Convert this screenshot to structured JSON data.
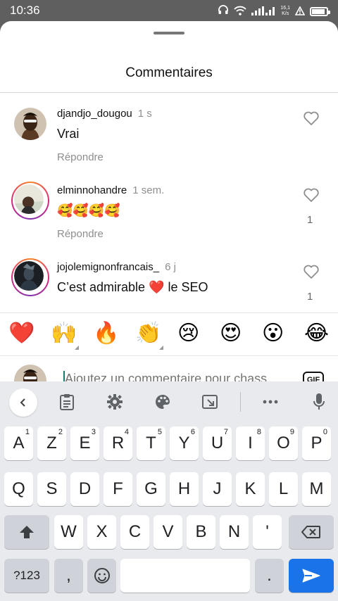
{
  "status_bar": {
    "time": "10:36",
    "net_speed_value": "16,1",
    "net_speed_unit": "K/s",
    "battery_percent": 90
  },
  "sheet": {
    "title": "Commentaires"
  },
  "comments": [
    {
      "username": "djandjo_dougou",
      "time": "1 s",
      "text": "Vrai",
      "reply_label": "Répondre",
      "likes": "",
      "story_ring": false
    },
    {
      "username": "elminnohandre",
      "time": "1 sem.",
      "text": "🥰🥰🥰🥰",
      "reply_label": "Répondre",
      "likes": "1",
      "story_ring": true
    },
    {
      "username": "jojolemignonfrancais_",
      "time": "6 j",
      "text": "C’est admirable ❤️ le SEO",
      "reply_label": "",
      "likes": "1",
      "story_ring": true
    }
  ],
  "emoji_bar": [
    "❤️",
    "🙌",
    "🔥",
    "👏",
    "😢",
    "😍",
    "😮",
    "😂"
  ],
  "comment_input": {
    "placeholder": "Ajoutez un commentaire pour chass",
    "gif_label": "GIF"
  },
  "keyboard": {
    "toolbar": [
      "back-icon",
      "clipboard-icon",
      "settings-icon",
      "theme-palette-icon",
      "screen-size-icon",
      "more-icon",
      "mic-icon"
    ],
    "row1": [
      {
        "key": "A",
        "hint": "1"
      },
      {
        "key": "Z",
        "hint": "2"
      },
      {
        "key": "E",
        "hint": "3"
      },
      {
        "key": "R",
        "hint": "4"
      },
      {
        "key": "T",
        "hint": "5"
      },
      {
        "key": "Y",
        "hint": "6"
      },
      {
        "key": "U",
        "hint": "7"
      },
      {
        "key": "I",
        "hint": "8"
      },
      {
        "key": "O",
        "hint": "9"
      },
      {
        "key": "P",
        "hint": "0"
      }
    ],
    "row2": [
      "Q",
      "S",
      "D",
      "F",
      "G",
      "H",
      "J",
      "K",
      "L",
      "M"
    ],
    "row3": [
      "W",
      "X",
      "C",
      "V",
      "B",
      "N",
      "'"
    ],
    "symbols_label": "?123",
    "comma": ",",
    "period": "."
  },
  "colors": {
    "accent": "#1a73e8",
    "caret": "#1b7a6e",
    "heart": "#e0245e"
  }
}
